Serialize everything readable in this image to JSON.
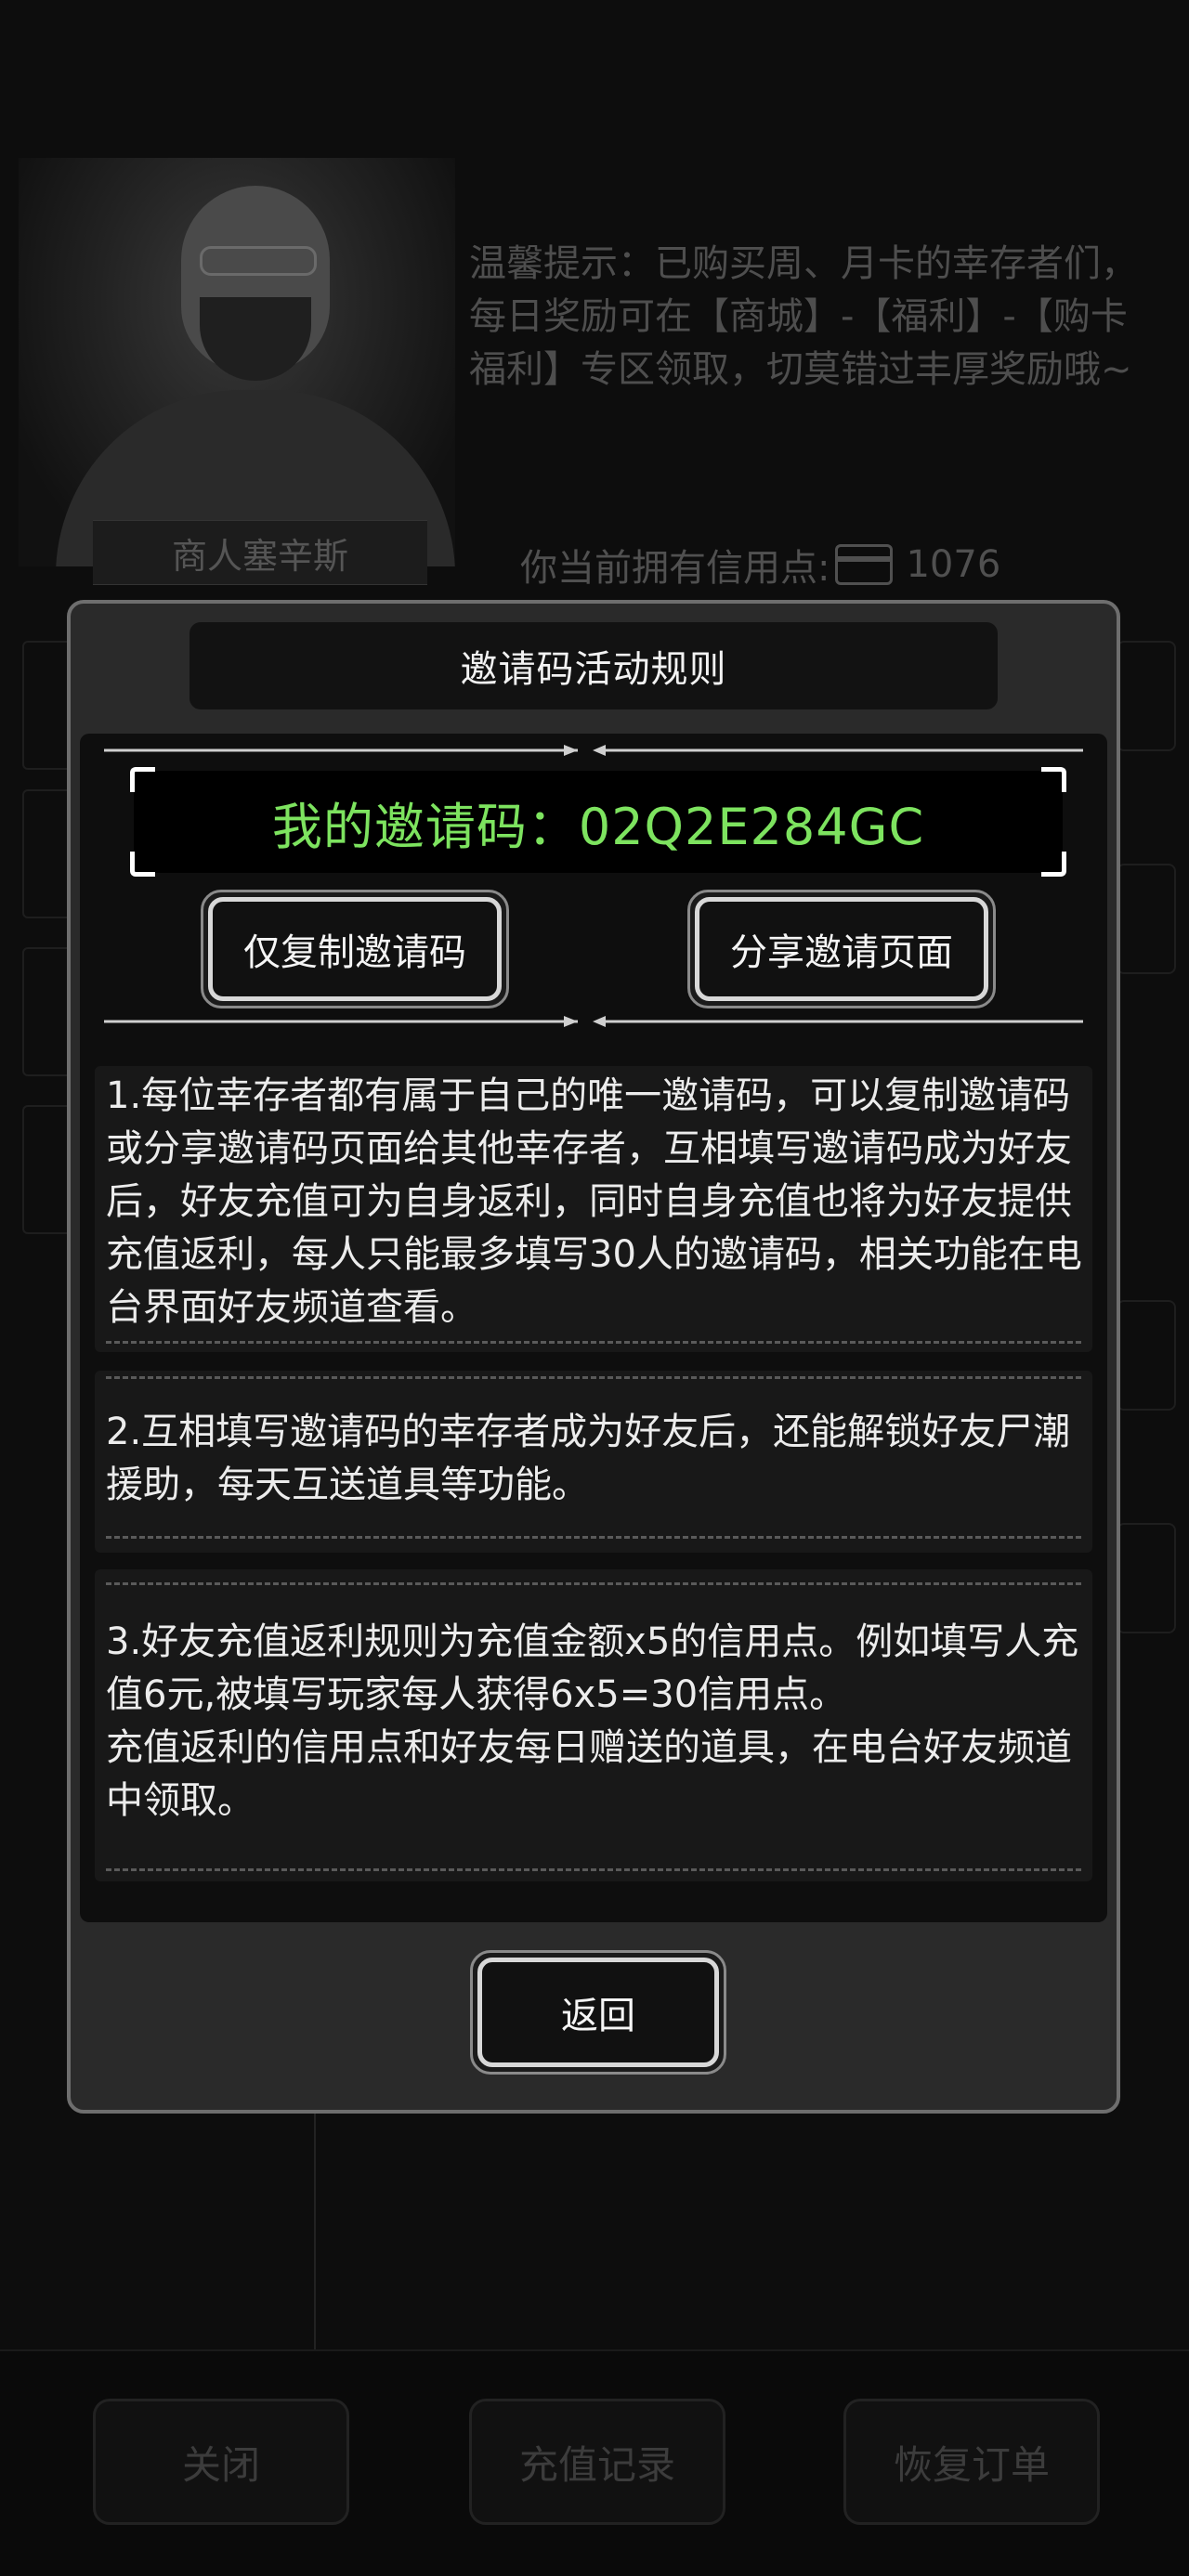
{
  "background": {
    "merchant_name": "商人塞辛斯",
    "tip": "温馨提示：已购买周、月卡的幸存者们，每日奖励可在【商城】-【福利】-【购卡福利】专区领取，切莫错过丰厚奖励哦~",
    "credit_label": "你当前拥有信用点:",
    "credit_value": "1076",
    "bottom_buttons": {
      "close": "关闭",
      "records": "充值记录",
      "restore": "恢复订单"
    }
  },
  "modal": {
    "title": "邀请码活动规则",
    "invite_code_text": "我的邀请码：02Q2E284GC",
    "copy_button": "仅复制邀请码",
    "share_button": "分享邀请页面",
    "rules": [
      "1.每位幸存者都有属于自己的唯一邀请码，可以复制邀请码或分享邀请码页面给其他幸存者，互相填写邀请码成为好友后，好友充值可为自身返利，同时自身充值也将为好友提供充值返利，每人只能最多填写30人的邀请码，相关功能在电台界面好友频道查看。",
      "2.互相填写邀请码的幸存者成为好友后，还能解锁好友尸潮援助，每天互送道具等功能。",
      "3.好友充值返利规则为充值金额x5的信用点。例如填写人充值6元,被填写玩家每人获得6x5=30信用点。\n充值返利的信用点和好友每日赠送的道具，在电台好友频道中领取。"
    ],
    "back_button": "返回"
  }
}
